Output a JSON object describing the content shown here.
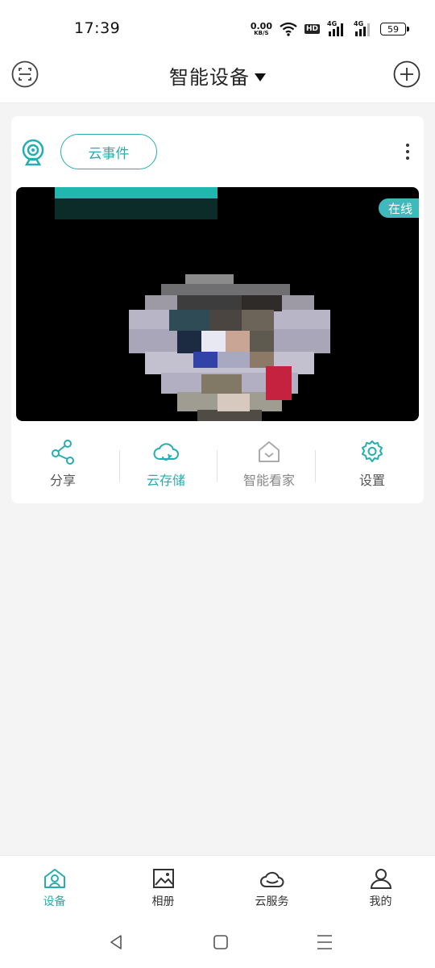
{
  "status_bar": {
    "time": "17:39",
    "net_speed_value": "0.00",
    "net_speed_unit": "KB/S",
    "hd_label": "HD",
    "signal_1_label": "4G",
    "signal_2_label": "4G",
    "battery_level": "59"
  },
  "app_bar": {
    "title": "智能设备"
  },
  "device_card": {
    "cloud_event_label": "云事件",
    "online_badge": "在线",
    "actions": [
      {
        "label": "分享",
        "icon": "share-icon"
      },
      {
        "label": "云存储",
        "icon": "cloud-icon"
      },
      {
        "label": "智能看家",
        "icon": "home-icon"
      },
      {
        "label": "设置",
        "icon": "gear-icon"
      }
    ]
  },
  "tab_bar": {
    "items": [
      {
        "label": "设备",
        "icon": "device-home-icon",
        "active": true
      },
      {
        "label": "相册",
        "icon": "album-icon",
        "active": false
      },
      {
        "label": "云服务",
        "icon": "cloud-service-icon",
        "active": false
      },
      {
        "label": "我的",
        "icon": "user-icon",
        "active": false
      }
    ]
  },
  "colors": {
    "accent": "#24aeb1",
    "badge": "#3fb9bb",
    "background": "#f4f4f5"
  }
}
